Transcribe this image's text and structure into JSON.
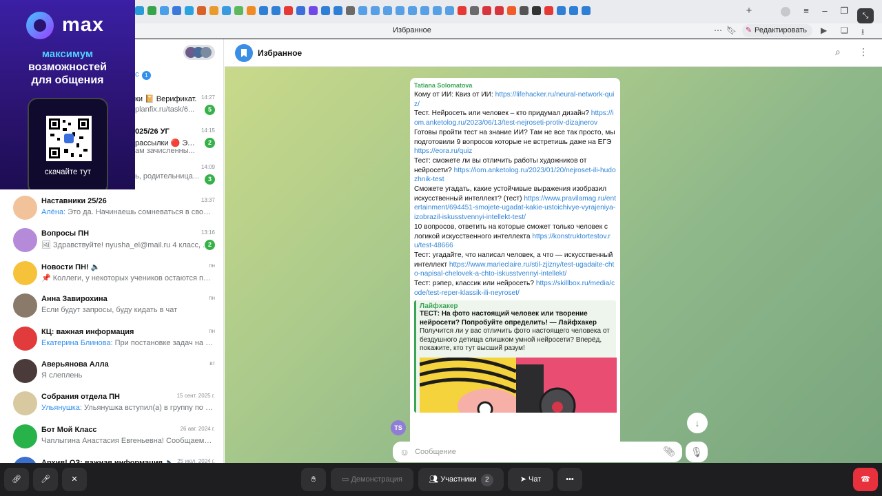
{
  "browser": {
    "page_title": "Избранное",
    "edit_label": "Редактировать",
    "tab_colors": [
      "#2a9bd8",
      "#37a34b",
      "#4aa0e8",
      "#3b7ad9",
      "#2aa3e0",
      "#d9622b",
      "#e89a2d",
      "#3a9ae0",
      "#5cb85c",
      "#f08a24",
      "#2f7fd6",
      "#2f7fd6",
      "#e53935",
      "#3b6fd9",
      "#7048e8",
      "#2f7fd6",
      "#2f7fd6",
      "#6b6b6b",
      "#58a0e6",
      "#58a0e6",
      "#58a0e6",
      "#58a0e6",
      "#58a0e6",
      "#58a0e6",
      "#58a0e6",
      "#58a0e6",
      "#e53935",
      "#6b6b6b",
      "#d9343b",
      "#d9343b",
      "#f25c2a",
      "#555",
      "#333",
      "#e53935",
      "#2f7fd6",
      "#2f7fd6",
      "#2f7fd6"
    ]
  },
  "ad": {
    "brand": "max",
    "line1": "максимум",
    "line2a": "возможностей",
    "line2b": "для общения",
    "download": "скачайте тут"
  },
  "header": {
    "title": "Избранное"
  },
  "chats": [
    {
      "name": "Наставники 25/26",
      "sender": "Алёна:",
      "preview": " Это да. Начинаешь сомневаться в своей ...",
      "time": "13:37",
      "badge": "",
      "avatar_color": "#f2c29b"
    },
    {
      "name": "Вопросы ПН",
      "sender": "",
      "preview": "🖼 Здравствуйте! nyusha_el@mail.ru 4 класс, ...",
      "time": "13:16",
      "badge": "2",
      "avatar_color": "#b58ad8"
    },
    {
      "name": "Новости ПН! 🔈",
      "sender": "",
      "preview": "📌 Коллеги, у некоторых учеников остаются про...",
      "time": "пн",
      "badge": "",
      "avatar_color": "#f6c23a"
    },
    {
      "name": "Анна Завирохина",
      "sender": "",
      "preview": "Если будут запросы, буду кидать в чат",
      "time": "пн",
      "badge": "",
      "avatar_color": "#8a7a6a"
    },
    {
      "name": "КЦ: важная информация",
      "sender": "Екатерина Блинова:",
      "preview": " При постановке задач на по...",
      "time": "пн",
      "badge": "",
      "avatar_color": "#e23b3b"
    },
    {
      "name": "Аверьянова Алла",
      "sender": "",
      "preview": "Я слеплень",
      "time": "вт",
      "badge": "",
      "avatar_color": "#4a3a3a"
    },
    {
      "name": "Собрания отдела ПН",
      "sender": "Ульянушка:",
      "preview": " Ульянушка вступил(а) в группу по сс...",
      "time": "15 сент. 2025 г.",
      "badge": "",
      "avatar_color": "#d9c9a0"
    },
    {
      "name": "Бот Мой Класс",
      "sender": "",
      "preview": "Чаплыгина Анастасия Евгеньевна! Сообщаем, ч...",
      "time": "26 авг. 2024 г.",
      "badge": "",
      "avatar_color": "#27b24a"
    },
    {
      "name": "Архив! ОЗ: важная информация 🔈",
      "sender": "",
      "preview": "",
      "time": "25 июл. 2024 г.",
      "badge": "",
      "avatar_color": "#3a6fd0"
    }
  ],
  "partial_chats": [
    {
      "preview_a": "ки  📔 Верификат...",
      "preview_b": "planfix.ru/task/6...",
      "time": "14:27",
      "badge": "5"
    },
    {
      "preview_a": "025/26 УГ",
      "preview_b": "рассылки 🔴 Элл...",
      "preview_c": "ам зачисленны...",
      "time": "14:15",
      "badge": "2"
    },
    {
      "preview_a": "ь, родительница...",
      "time": "14:09",
      "badge": "3"
    }
  ],
  "folder_badge": "1",
  "message": {
    "author": "Tatiana Solomatova",
    "l1": "Кому от ИИ: Квиз от ИИ: ",
    "l1_link": "https://lifehacker.ru/neural-network-quiz/",
    "l2": "Тест. Нейросеть или человек – кто придумал дизайн? ",
    "l2_link": "https://iom.anketolog.ru/2023/06/13/test-nejroseti-protiv-dizajnerov",
    "l3": "Готовы пройти тест на знание ИИ? Там не все так просто, мы подготовили 9 вопросов которые не встретишь даже на ЕГЭ ",
    "l3_link": "https://eora.ru/quiz",
    "l4": "Тест: сможете ли вы отличить работы художников от нейросети? ",
    "l4_link": "https://iom.anketolog.ru/2023/01/20/nejroset-ili-hudozhnik-test",
    "l5": "Сможете угадать, какие устойчивые выражения изобразил искусственный интеллект? (тест) ",
    "l5_link": "https://www.pravilamag.ru/entertainment/694451-smojete-ugadat-kakie-ustoichivye-vyrajeniya-izobrazil-iskusstvennyi-intellekt-test/",
    "l6": "10 вопросов, ответить на которые сможет только человек с логикой искусственного интеллекта  ",
    "l6_link": "https://konstruktortestov.ru/test-48666",
    "l7": "Тест: угадайте, что написал человек, а что — искусственный интеллект ",
    "l7_link": "https://www.marieclaire.ru/stil-zjizny/test-ugadaite-chto-napisal-chelovek-a-chto-iskusstvennyi-intellekt/",
    "l8": "Тест: рэпер, классик или нейросеть? ",
    "l8_link": "https://skillbox.ru/media/code/test-reper-klassik-ili-neyroset/",
    "card_site": "Лайфхакер",
    "card_title": "ТЕСТ: На фото настоящий человек или творение нейросети? Попробуйте определить! — Лайфхакер",
    "card_desc": "Получится ли у вас отличить фото настоящего человека от бездушного детища слишком умной нейросети? Вперёд, покажите, кто тут высший разум!"
  },
  "composer": {
    "placeholder": "Сообщение",
    "ts_initials": "TS"
  },
  "confbar": {
    "demo": "Демонстрация",
    "participants": "Участники",
    "participants_count": "2",
    "chat": "Чат"
  }
}
